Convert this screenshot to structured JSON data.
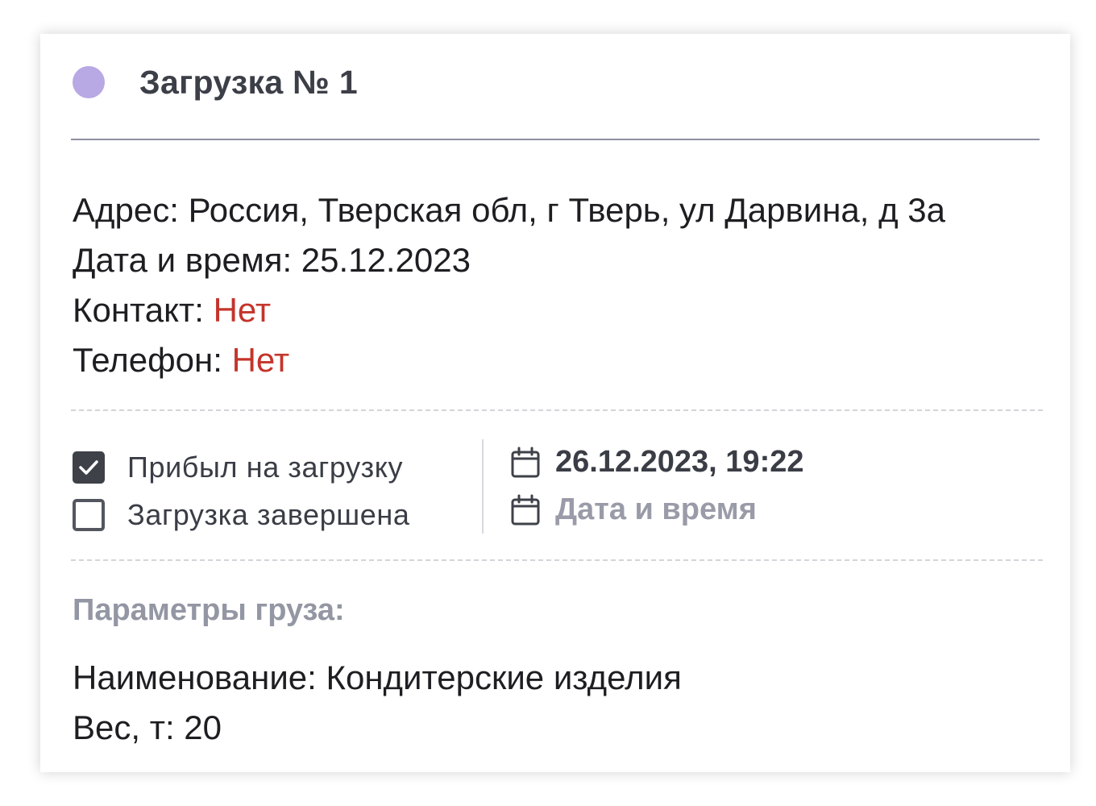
{
  "header": {
    "title": "Загрузка № 1",
    "status_color": "#b8a8e3"
  },
  "info": {
    "address_label": "Адрес: ",
    "address_value": "Россия, Тверская обл, г Тверь, ул Дарвина, д 3а",
    "datetime_label": "Дата и время: ",
    "datetime_value": "25.12.2023",
    "contact_label": "Контакт: ",
    "contact_value": "Нет",
    "phone_label": "Телефон: ",
    "phone_value": "Нет"
  },
  "checks": [
    {
      "label": "Прибыл на загрузку",
      "checked": true
    },
    {
      "label": "Загрузка завершена",
      "checked": false
    }
  ],
  "dates": {
    "arrived_value": "26.12.2023, 19:22",
    "completed_placeholder": "Дата и время"
  },
  "cargo": {
    "section_title": "Параметры груза:",
    "name_label": "Наименование: ",
    "name_value": "Кондитерские изделия",
    "weight_label": "Вес, т: ",
    "weight_value": "20"
  },
  "colors": {
    "missing_value": "#c4342b",
    "accent_dot": "#b8a8e3"
  },
  "icons": {
    "check": "checkmark-icon",
    "calendar": "calendar-icon"
  }
}
